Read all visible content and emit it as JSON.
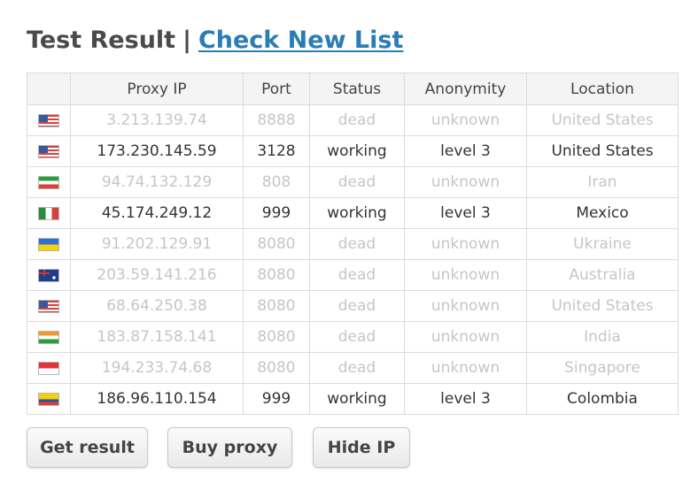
{
  "heading": {
    "title": "Test Result",
    "separator": "|",
    "link": "Check New List"
  },
  "table": {
    "columns": [
      "",
      "Proxy IP",
      "Port",
      "Status",
      "Anonymity",
      "Location"
    ],
    "rows": [
      {
        "flag": "us-flag-icon",
        "ip": "3.213.139.74",
        "port": "8888",
        "status": "dead",
        "anonymity": "unknown",
        "location": "United States"
      },
      {
        "flag": "us-flag-icon",
        "ip": "173.230.145.59",
        "port": "3128",
        "status": "working",
        "anonymity": "level 3",
        "location": "United States"
      },
      {
        "flag": "ir-flag-icon",
        "ip": "94.74.132.129",
        "port": "808",
        "status": "dead",
        "anonymity": "unknown",
        "location": "Iran"
      },
      {
        "flag": "mx-flag-icon",
        "ip": "45.174.249.12",
        "port": "999",
        "status": "working",
        "anonymity": "level 3",
        "location": "Mexico"
      },
      {
        "flag": "ua-flag-icon",
        "ip": "91.202.129.91",
        "port": "8080",
        "status": "dead",
        "anonymity": "unknown",
        "location": "Ukraine"
      },
      {
        "flag": "au-flag-icon",
        "ip": "203.59.141.216",
        "port": "8080",
        "status": "dead",
        "anonymity": "unknown",
        "location": "Australia"
      },
      {
        "flag": "us-flag-icon",
        "ip": "68.64.250.38",
        "port": "8080",
        "status": "dead",
        "anonymity": "unknown",
        "location": "United States"
      },
      {
        "flag": "in-flag-icon",
        "ip": "183.87.158.141",
        "port": "8080",
        "status": "dead",
        "anonymity": "unknown",
        "location": "India"
      },
      {
        "flag": "sg-flag-icon",
        "ip": "194.233.74.68",
        "port": "8080",
        "status": "dead",
        "anonymity": "unknown",
        "location": "Singapore"
      },
      {
        "flag": "co-flag-icon",
        "ip": "186.96.110.154",
        "port": "999",
        "status": "working",
        "anonymity": "level 3",
        "location": "Colombia"
      }
    ]
  },
  "buttons": {
    "get_result": "Get result",
    "buy_proxy": "Buy proxy",
    "hide_ip": "Hide IP"
  },
  "colors": {
    "link": "#2a7db5",
    "dead_text": "#c6c6c6",
    "working_text": "#333333",
    "header_bg": "#f4f4f4",
    "border": "#dcdcdc"
  }
}
